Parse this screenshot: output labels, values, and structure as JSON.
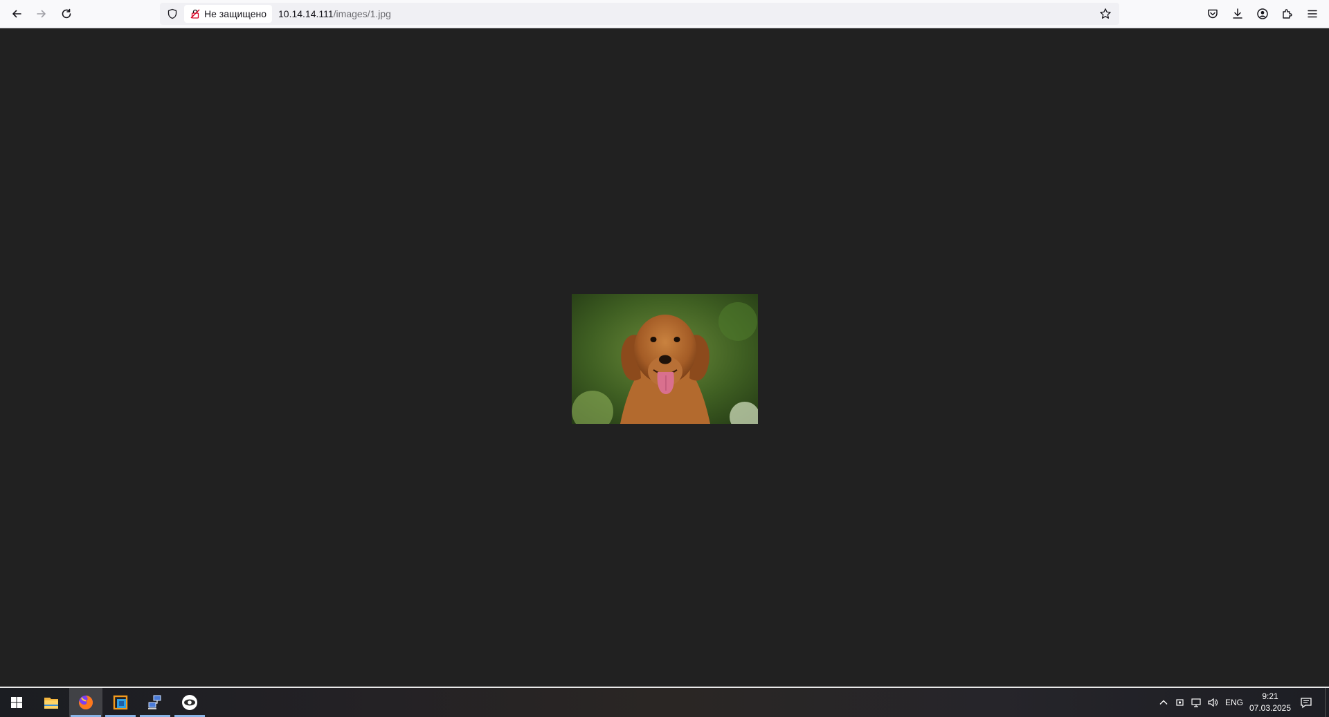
{
  "browser": {
    "security_label": "Не защищено",
    "url_host": "10.14.14.111",
    "url_path": "/images/1.jpg"
  },
  "content": {
    "image_subject": "golden retriever photo"
  },
  "taskbar": {
    "apps": [
      "start",
      "file-explorer",
      "firefox",
      "virtual-machine-app",
      "network-app",
      "remote-viewer-app"
    ],
    "language": "ENG",
    "time": "9:21",
    "date": "07.03.2025"
  },
  "colors": {
    "page_bg": "#212121",
    "toolbar_bg": "#f9f9fb",
    "urlbar_bg": "#f0f0f4",
    "insecure_icon": "#d70022"
  }
}
